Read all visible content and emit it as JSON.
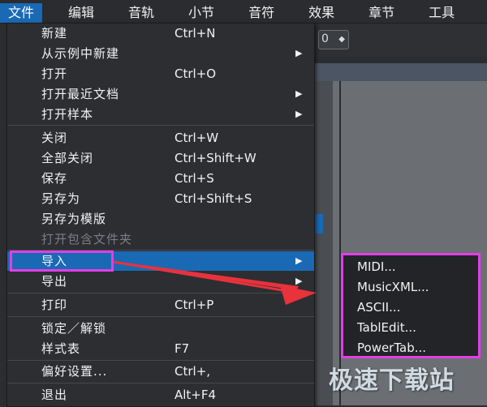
{
  "menubar": {
    "items": [
      "文件",
      "编辑",
      "音轨",
      "小节",
      "音符",
      "效果",
      "章节",
      "工具"
    ]
  },
  "toolbar": {
    "select_value": "0"
  },
  "file_menu": {
    "items": [
      {
        "label": "新建",
        "shortcut": "Ctrl+N",
        "submenu": false
      },
      {
        "label": "从示例中新建",
        "shortcut": "",
        "submenu": true
      },
      {
        "label": "打开",
        "shortcut": "Ctrl+O",
        "submenu": false
      },
      {
        "label": "打开最近文档",
        "shortcut": "",
        "submenu": true
      },
      {
        "label": "打开样本",
        "shortcut": "",
        "submenu": true
      },
      {
        "label": "关闭",
        "shortcut": "Ctrl+W",
        "submenu": false
      },
      {
        "label": "全部关闭",
        "shortcut": "Ctrl+Shift+W",
        "submenu": false
      },
      {
        "label": "保存",
        "shortcut": "Ctrl+S",
        "submenu": false
      },
      {
        "label": "另存为",
        "shortcut": "Ctrl+Shift+S",
        "submenu": false
      },
      {
        "label": "另存为模版",
        "shortcut": "",
        "submenu": false
      },
      {
        "label": "打开包含文件夹",
        "shortcut": "",
        "submenu": false,
        "disabled": true
      },
      {
        "label": "导入",
        "shortcut": "",
        "submenu": true,
        "highlighted": true
      },
      {
        "label": "导出",
        "shortcut": "",
        "submenu": true
      },
      {
        "label": "打印",
        "shortcut": "Ctrl+P",
        "submenu": false
      },
      {
        "label": "锁定／解锁",
        "shortcut": "",
        "submenu": false
      },
      {
        "label": "样式表",
        "shortcut": "F7",
        "submenu": false
      },
      {
        "label": "偏好设置...",
        "shortcut": "Ctrl+,",
        "submenu": false
      },
      {
        "label": "退出",
        "shortcut": "Alt+F4",
        "submenu": false
      }
    ]
  },
  "import_submenu": {
    "items": [
      "MIDI...",
      "MusicXML...",
      "ASCII...",
      "TablEdit...",
      "PowerTab..."
    ]
  },
  "watermark": "极速下载站",
  "colors": {
    "accent": "#1a69b5",
    "annotation": "#e23ee6",
    "arrow": "#e8323c"
  }
}
